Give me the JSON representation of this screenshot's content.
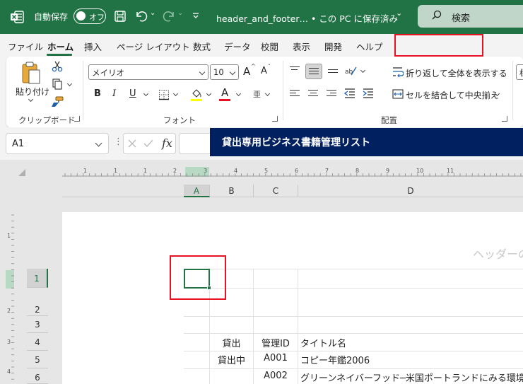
{
  "titlebar": {
    "autosave_label": "自動保存",
    "toggle_state": "オフ",
    "filename": "header_and_footer… • この PC に保存済み",
    "filename_chevron": "⌄",
    "search_label": "検索"
  },
  "menu": {
    "tabs": [
      "ファイル",
      "ホーム",
      "挿入",
      "ページ レイアウト",
      "数式",
      "データ",
      "校閲",
      "表示",
      "開発",
      "ヘルプ"
    ],
    "active": "ホーム"
  },
  "ribbon": {
    "clipboard": {
      "paste_label": "貼り付け",
      "group_label": "クリップボード"
    },
    "font": {
      "font_name": "メイリオ",
      "font_size": "10",
      "bold": "B",
      "italic": "I",
      "underline": "U",
      "grow": "A",
      "shrink": "A",
      "font_color_glyph": "A",
      "phonetic": "亜",
      "group_label": "フォント"
    },
    "alignment": {
      "wrap_label": "折り返して全体を表示する",
      "merge_label": "セルを結合して中央揃え",
      "group_label": "配置"
    },
    "number_cutoff": "標"
  },
  "formula_bar": {
    "name_box": "A1",
    "fx": "fx",
    "more": "⋮"
  },
  "sheet": {
    "columns": [
      "A",
      "B",
      "C",
      "D"
    ],
    "selected_column": "A",
    "rows": [
      "1",
      "2",
      "3",
      "4",
      "5",
      "6"
    ],
    "selected_row": "1",
    "header_placeholder": "ヘッダーの",
    "title": "貸出専用ビジネス書籍管理リスト",
    "table_headers": [
      "貸出",
      "管理ID",
      "タイトル名"
    ],
    "table_rows": [
      [
        "貸出中",
        "A001",
        "コピー年鑑2006"
      ],
      [
        "",
        "A002",
        "グリーンネイバーフッド─米国ポートランドにみる環境"
      ]
    ],
    "ruler_h": [
      "1",
      "1",
      "1",
      "2",
      "3",
      "4",
      "5",
      "6",
      "7",
      "8",
      "9",
      "10",
      "11"
    ],
    "ruler_v": [
      "1",
      "2",
      "3",
      "4"
    ]
  },
  "colors": {
    "excel_green": "#217346",
    "title_fill": "#002060",
    "highlight_red": "#e81123"
  }
}
